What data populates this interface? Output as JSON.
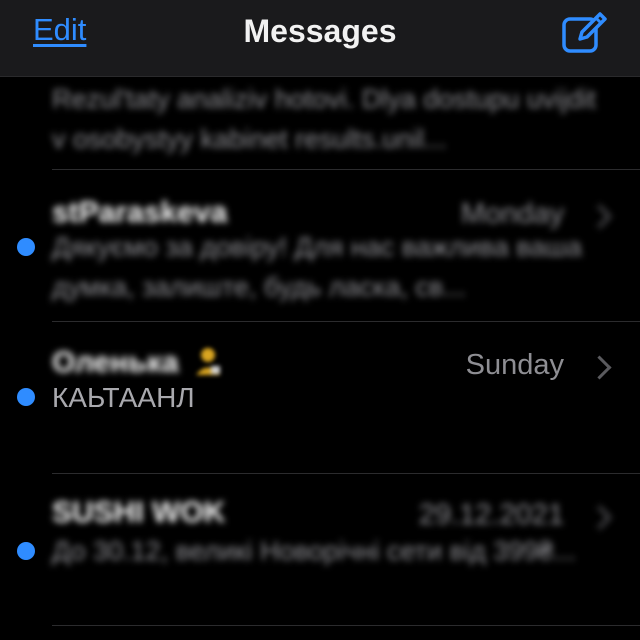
{
  "nav": {
    "edit_label": "Edit",
    "title": "Messages",
    "compose_icon": "compose-icon",
    "accent_color": "#2f8cff"
  },
  "messages": [
    {
      "sender": "",
      "date": "",
      "unread": false,
      "preview": "Rezul'taty analiziv hotovi. Dlya dostupu uvijdit v osobystyy kabinet results.unil..."
    },
    {
      "sender": "stParaskeva",
      "date": "Monday",
      "unread": true,
      "preview": "Дякуємо за довіру! Для нас важлива ваша думка, залиште, будь ласка, св..."
    },
    {
      "sender": "Оленька",
      "date": "Sunday",
      "unread": true,
      "preview": "КАЬТААНЛ"
    },
    {
      "sender": "SUSHI WOK",
      "date": "29.12.2021",
      "unread": true,
      "preview": "До 30.12, великі Новорічні сети від 399₴..."
    }
  ]
}
